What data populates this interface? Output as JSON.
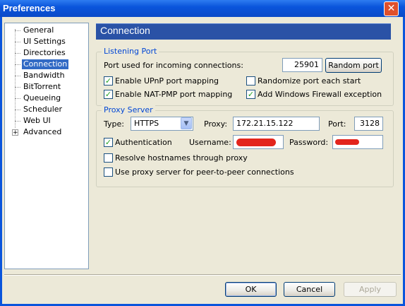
{
  "window": {
    "title": "Preferences",
    "close_glyph": "✕"
  },
  "tree": {
    "items": [
      {
        "label": "General"
      },
      {
        "label": "UI Settings"
      },
      {
        "label": "Directories"
      },
      {
        "label": "Connection",
        "selected": true
      },
      {
        "label": "Bandwidth"
      },
      {
        "label": "BitTorrent"
      },
      {
        "label": "Queueing"
      },
      {
        "label": "Scheduler"
      },
      {
        "label": "Web UI"
      },
      {
        "label": "Advanced",
        "expandable": true
      }
    ],
    "expand_glyph": "+"
  },
  "page": {
    "header": "Connection"
  },
  "listening_port": {
    "title": "Listening Port",
    "port_label": "Port used for incoming connections:",
    "port_value": "25901",
    "random_port_button": "Random port",
    "upnp": {
      "label": "Enable UPnP port mapping",
      "checked": true
    },
    "randomize": {
      "label": "Randomize port each start",
      "checked": false
    },
    "natpmp": {
      "label": "Enable NAT-PMP port mapping",
      "checked": true
    },
    "firewall": {
      "label": "Add Windows Firewall exception",
      "checked": true
    }
  },
  "proxy_server": {
    "title": "Proxy Server",
    "type_label": "Type:",
    "type_value": "HTTPS",
    "proxy_label": "Proxy:",
    "proxy_value": "172.21.15.122",
    "port_label": "Port:",
    "port_value": "3128",
    "auth": {
      "label": "Authentication",
      "checked": true
    },
    "username_label": "Username:",
    "password_label": "Password:",
    "resolve": {
      "label": "Resolve hostnames through proxy",
      "checked": false
    },
    "p2p": {
      "label": "Use proxy server for peer-to-peer connections",
      "checked": false
    }
  },
  "buttons": {
    "ok": "OK",
    "cancel": "Cancel",
    "apply": "Apply"
  },
  "check_glyph": "✓",
  "dropdown_glyph": "▼",
  "colors": {
    "titlebar": "#0A55DC",
    "header": "#2A52A6",
    "selection": "#316AC5",
    "group_title": "#0046D5",
    "redaction": "#E3251C"
  }
}
